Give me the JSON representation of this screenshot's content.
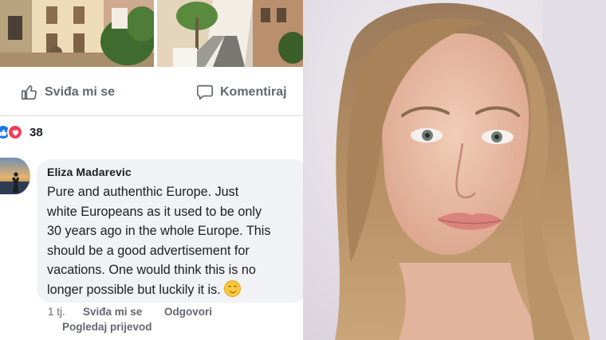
{
  "post": {
    "actions": {
      "like_label": "Sviđa mi se",
      "comment_label": "Komentiraj",
      "like_icon": "thumbs-up-icon",
      "comment_icon": "speech-bubble-icon"
    },
    "reactions": {
      "types": [
        "like",
        "love"
      ],
      "count": "38",
      "colors": {
        "like": "#1877f2",
        "love": "#f33e58"
      }
    }
  },
  "comment": {
    "author": "Eliza Madarevic",
    "lines": [
      "Pure and authenthic Europe. Just",
      "white Europeans as it used to be only",
      "30 years ago in the whole Europe. This",
      "should be a good advertisement for",
      "vacations. One would think this is no",
      "longer possible but luckily it is."
    ],
    "emoji": "smiling-face-icon",
    "time": "1 tj.",
    "like_label": "Sviđa mi se",
    "reply_label": "Odgovori",
    "translate_label": "Pogledaj prijevod"
  },
  "colors": {
    "meta_text": "#65676b",
    "bubble_bg": "#f0f2f5",
    "divider": "#dadde1"
  }
}
